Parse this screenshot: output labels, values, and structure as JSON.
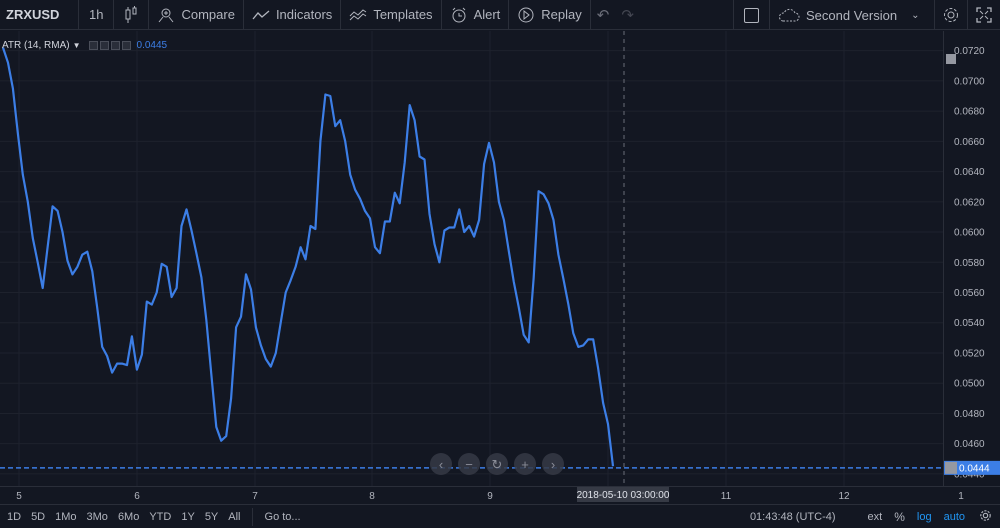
{
  "toolbar": {
    "symbol": "ZRXUSD",
    "interval": "1h",
    "compare": "Compare",
    "indicators": "Indicators",
    "templates": "Templates",
    "alert": "Alert",
    "replay": "Replay",
    "layout_name": "Second Version"
  },
  "legend": {
    "title": "ATR (14, RMA)",
    "value": "0.0445"
  },
  "price_scale": {
    "labels": [
      "0.0720",
      "0.0700",
      "0.0680",
      "0.0660",
      "0.0640",
      "0.0620",
      "0.0600",
      "0.0580",
      "0.0560",
      "0.0540",
      "0.0520",
      "0.0500",
      "0.0480",
      "0.0460",
      "0.0440"
    ],
    "current_value": "0.0444"
  },
  "time_scale": {
    "labels": [
      "5",
      "6",
      "7",
      "8",
      "9",
      "11",
      "12",
      "1"
    ],
    "crosshair_label": "2018-05-10 03:00:00"
  },
  "bottom_bar": {
    "ranges": [
      "1D",
      "5D",
      "1Mo",
      "3Mo",
      "6Mo",
      "YTD",
      "1Y",
      "5Y",
      "All"
    ],
    "goto": "Go to...",
    "clock": "01:43:48 (UTC-4)",
    "ext": "ext",
    "percent": "%",
    "log": "log",
    "auto": "auto"
  },
  "colors": {
    "background": "#131722",
    "line": "#3c7ee6",
    "grid": "#1e222d",
    "active": "#2196f3"
  },
  "chart_data": {
    "type": "line",
    "title": "",
    "series": [
      {
        "name": "ATR (14, RMA)",
        "values": [
          0.0722,
          0.0712,
          0.0695,
          0.0665,
          0.0638,
          0.062,
          0.0596,
          0.058,
          0.0563,
          0.059,
          0.0617,
          0.0614,
          0.06,
          0.0581,
          0.0572,
          0.0577,
          0.0585,
          0.0587,
          0.0574,
          0.055,
          0.0524,
          0.0518,
          0.0507,
          0.0513,
          0.0513,
          0.0512,
          0.0531,
          0.0509,
          0.0519,
          0.0554,
          0.0552,
          0.056,
          0.0579,
          0.0577,
          0.0557,
          0.0563,
          0.0604,
          0.0615,
          0.0601,
          0.0586,
          0.057,
          0.0542,
          0.0506,
          0.0471,
          0.0462,
          0.0465,
          0.049,
          0.0537,
          0.0544,
          0.0572,
          0.0562,
          0.0537,
          0.0525,
          0.0516,
          0.0511,
          0.052,
          0.054,
          0.056,
          0.0568,
          0.0577,
          0.059,
          0.0582,
          0.0604,
          0.0602,
          0.066,
          0.0691,
          0.069,
          0.067,
          0.0674,
          0.066,
          0.0638,
          0.0628,
          0.0622,
          0.0614,
          0.0609,
          0.059,
          0.0586,
          0.0607,
          0.0607,
          0.0626,
          0.0619,
          0.0646,
          0.0684,
          0.0674,
          0.065,
          0.0648,
          0.0612,
          0.0592,
          0.058,
          0.0601,
          0.0603,
          0.0603,
          0.0615,
          0.06,
          0.0604,
          0.0597,
          0.0608,
          0.0645,
          0.0659,
          0.0646,
          0.062,
          0.0608,
          0.0587,
          0.0567,
          0.055,
          0.0532,
          0.0527,
          0.057,
          0.0627,
          0.0625,
          0.0619,
          0.0608,
          0.0585,
          0.0569,
          0.0552,
          0.0533,
          0.0524,
          0.0525,
          0.0529,
          0.0529,
          0.051,
          0.0487,
          0.0473,
          0.0445
        ]
      }
    ],
    "x_labels": [
      "5",
      "6",
      "7",
      "8",
      "9",
      "10",
      "11",
      "12"
    ],
    "y_range": [
      0.0432,
      0.0733
    ],
    "y_ticks": [
      0.072,
      0.07,
      0.068,
      0.066,
      0.064,
      0.062,
      0.06,
      0.058,
      0.056,
      0.054,
      0.052,
      0.05,
      0.048,
      0.046,
      0.044
    ],
    "current_value": 0.0444,
    "grid": true
  }
}
